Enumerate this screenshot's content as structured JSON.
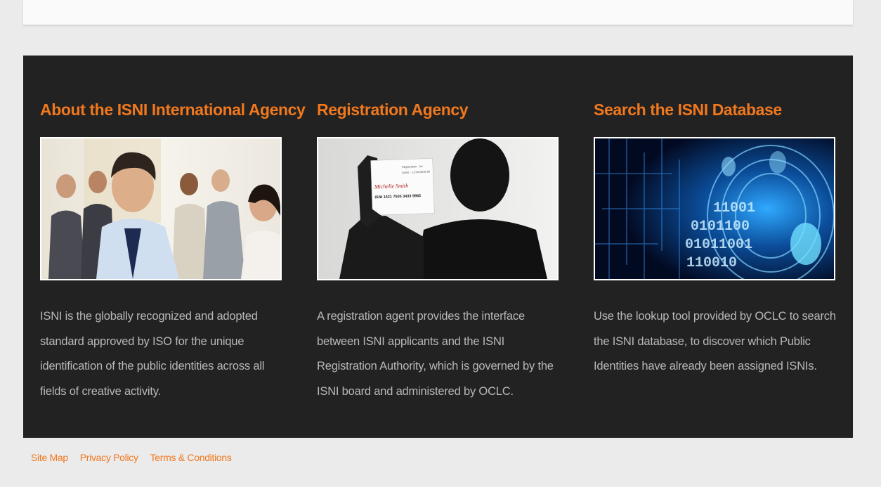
{
  "columns": [
    {
      "title": "About the ISNI International Agency",
      "text": "ISNI is the globally recognized and adopted standard approved by ISO for the unique identification of the public identities across all fields of creative activity."
    },
    {
      "title": "Registration Agency",
      "text": "A registration agent provides the interface between ISNI applicants and the ISNI Registration Authority, which is governed by the ISNI board and administered by OCLC."
    },
    {
      "title": "Search the ISNI Database",
      "text": "Use the lookup tool provided by OCLC to search the ISNI database, to discover which Public Identities have already been assigned ISNIs."
    }
  ],
  "images": {
    "card_name": "Michelle Smith",
    "card_isni": "ISNI 1421 7505 3433 9962",
    "card_line1": "Registration · Inc",
    "card_line2": "name · 1-234-5678-90",
    "binary_rows": [
      "11001",
      "0101100",
      "01011001",
      "110010"
    ]
  },
  "footer": {
    "links": [
      "Site Map",
      "Privacy Policy",
      "Terms & Conditions"
    ]
  },
  "colors": {
    "accent": "#f0781e",
    "panel": "#222222",
    "body_text": "#b8b8b8",
    "page_bg": "#ebebeb"
  }
}
